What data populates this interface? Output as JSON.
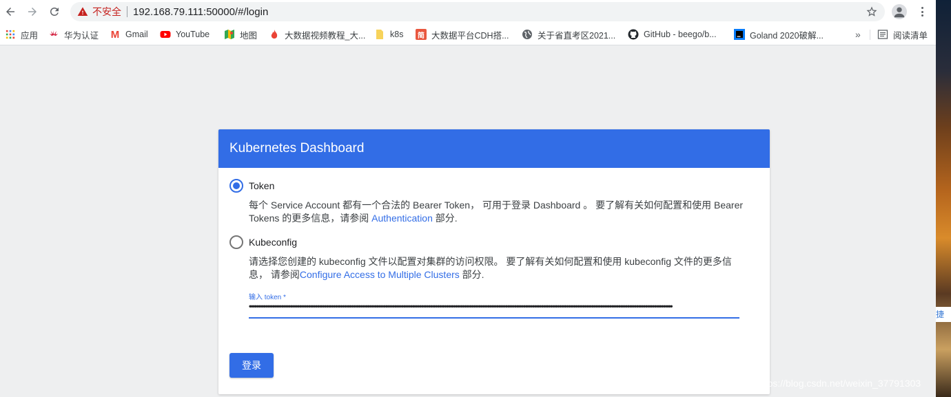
{
  "browser": {
    "insecure_label": "不安全",
    "url": "192.168.79.111:50000/#/login"
  },
  "bookmarks": [
    {
      "label": "应用",
      "icon": "apps-grid-icon"
    },
    {
      "label": "华为认证",
      "icon": "huawei-icon"
    },
    {
      "label": "Gmail",
      "icon": "gmail-icon"
    },
    {
      "label": "YouTube",
      "icon": "youtube-icon"
    },
    {
      "label": "地图",
      "icon": "maps-icon"
    },
    {
      "label": "大数据视频教程_大...",
      "icon": "flame-icon"
    },
    {
      "label": "k8s",
      "icon": "folder-icon"
    },
    {
      "label": "大数据平台CDH搭...",
      "icon": "jianshu-icon"
    },
    {
      "label": "关于省直考区2021...",
      "icon": "globe-icon"
    },
    {
      "label": "GitHub - beego/b...",
      "icon": "github-icon"
    },
    {
      "label": "Goland 2020破解...",
      "icon": "goland-icon"
    },
    {
      "label": "阅读清单",
      "icon": "reading-list-icon"
    }
  ],
  "card": {
    "title": "Kubernetes Dashboard",
    "token_option": "Token",
    "token_desc_1": "每个 Service Account 都有一个合法的 Bearer Token， 可用于登录 Dashboard 。 要了解有关如何配置和使用 Bearer Tokens 的更多信息，请参阅 ",
    "token_link": "Authentication",
    "token_desc_2": " 部分.",
    "kubeconfig_option": "Kubeconfig",
    "kubeconfig_desc_1": "请选择您创建的 kubeconfig 文件以配置对集群的访问权限。 要了解有关如何配置和使用 kubeconfig 文件的更多信息， 请参阅",
    "kubeconfig_link": "Configure Access to Multiple Clusters",
    "kubeconfig_desc_2": " 部分.",
    "field_label": "输入 token *",
    "field_value": "••••••••••••••••••••••••••••••••••••••••••••••••••••••••••••••••••••••••••••••••••••••••••••••••••••••••••••••••••••••••••••••••••••••••••••••••••••••••••••••••••••••••••••••••••••••••••••••••••••••••••••••••••••••••••••••••••••••••••••",
    "login_button": "登录",
    "selected_option": "Token",
    "accent_color": "#326de6"
  },
  "side_strip_text": "捷上",
  "watermark": "https://blog.csdn.net/weixin_37791303"
}
